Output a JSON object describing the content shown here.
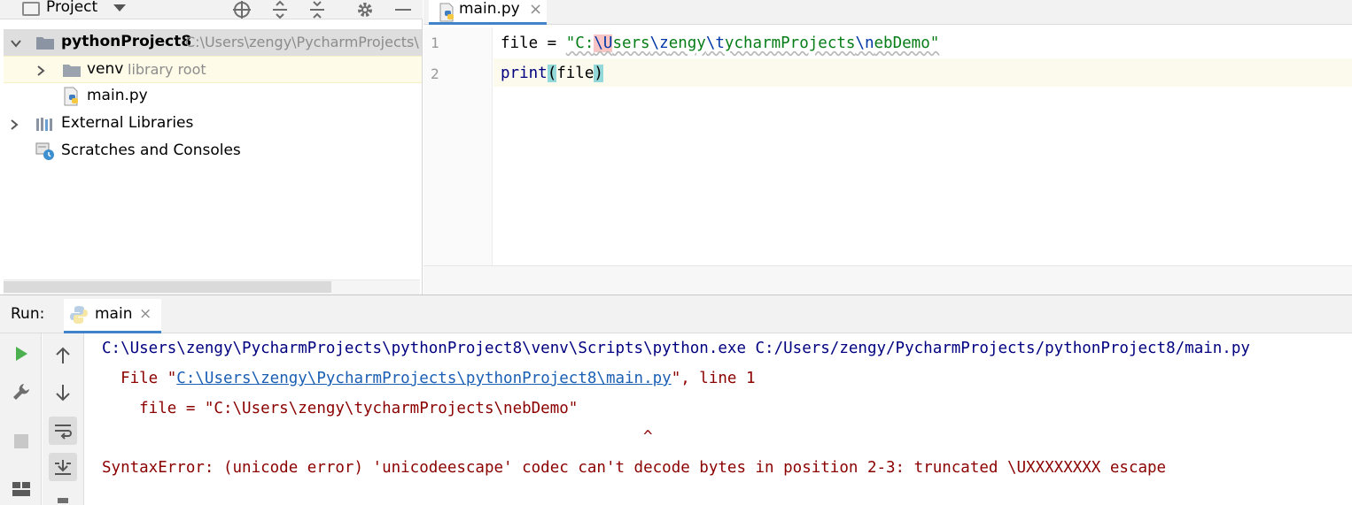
{
  "project_panel": {
    "title": "Project",
    "toolbar_icons": [
      "crosshair-icon",
      "expand-all-icon",
      "collapse-all-icon",
      "gear-icon",
      "minimize-icon"
    ],
    "tree": [
      {
        "name": "pythonProject8",
        "hint": "C:\\Users\\zengy\\PycharmProjects\\",
        "kind": "project-root"
      },
      {
        "name": "venv",
        "hint": "library root",
        "kind": "folder"
      },
      {
        "name": "main.py",
        "kind": "python-file"
      },
      {
        "name": "External Libraries",
        "kind": "libraries"
      },
      {
        "name": "Scratches and Consoles",
        "kind": "scratches"
      }
    ]
  },
  "editor": {
    "tab_label": "main.py",
    "tab_close": "×",
    "line_numbers": [
      "1",
      "2"
    ],
    "line1": {
      "p1": "file = ",
      "p2": "\"C:",
      "p3": "\\U",
      "p4": "sers",
      "p5": "\\z",
      "p6": "engy",
      "p7": "\\t",
      "p8": "ycharmProjects",
      "p9": "\\n",
      "p10": "ebDemo\""
    },
    "line2": {
      "fn": "print",
      "open": "(",
      "arg": "file",
      "close": ")"
    }
  },
  "run_panel": {
    "label": "Run:",
    "tab_label": "main",
    "tab_close": "×",
    "output": {
      "line1": "C:\\Users\\zengy\\PycharmProjects\\pythonProject8\\venv\\Scripts\\python.exe C:/Users/zengy/PycharmProjects/pythonProject8/main.py",
      "line2_prefix": "  File \"",
      "line2_link": "C:\\Users\\zengy\\PycharmProjects\\pythonProject8\\main.py",
      "line2_suffix": "\", line 1",
      "line3": "    file = \"C:\\Users\\zengy\\tycharmProjects\\nebDemo\"",
      "line4": "^",
      "line5": "SyntaxError: (unicode error) 'unicodeescape' codec can't decode bytes in position 2-3: truncated \\UXXXXXXXX escape"
    }
  }
}
